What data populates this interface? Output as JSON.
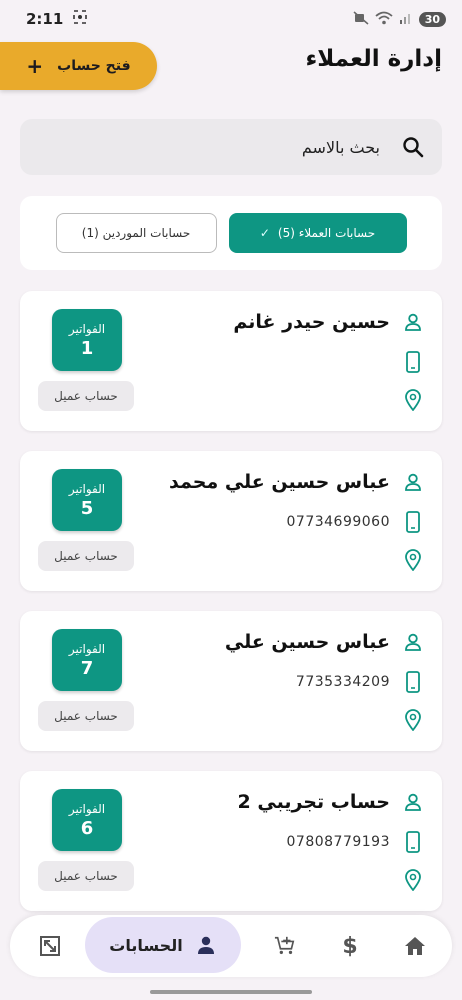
{
  "status_bar": {
    "time": "2:11",
    "battery": "30"
  },
  "header": {
    "title": "إدارة العملاء",
    "open_account_label": "فتح حساب"
  },
  "search": {
    "placeholder": "بحث بالاسم"
  },
  "filters": {
    "customers": "حسابات العملاء (5)",
    "suppliers": "حسابات الموردين (1)"
  },
  "customers": [
    {
      "name": "حسين حيدر غانم",
      "phone": "",
      "invoices_label": "الفواتير",
      "invoices_count": "1",
      "type": "حساب عميل"
    },
    {
      "name": "عباس حسين علي محمد",
      "phone": "07734699060",
      "invoices_label": "الفواتير",
      "invoices_count": "5",
      "type": "حساب عميل"
    },
    {
      "name": "عباس حسين علي",
      "phone": "7735334209",
      "invoices_label": "الفواتير",
      "invoices_count": "7",
      "type": "حساب عميل"
    },
    {
      "name": "حساب تجريبي 2",
      "phone": "07808779193",
      "invoices_label": "الفواتير",
      "invoices_count": "6",
      "type": "حساب عميل"
    }
  ],
  "bottom_nav": {
    "accounts_label": "الحسابات"
  },
  "colors": {
    "accent": "#0e9683",
    "open_button": "#e9aa2b",
    "nav_active": "#e5e0f7"
  }
}
